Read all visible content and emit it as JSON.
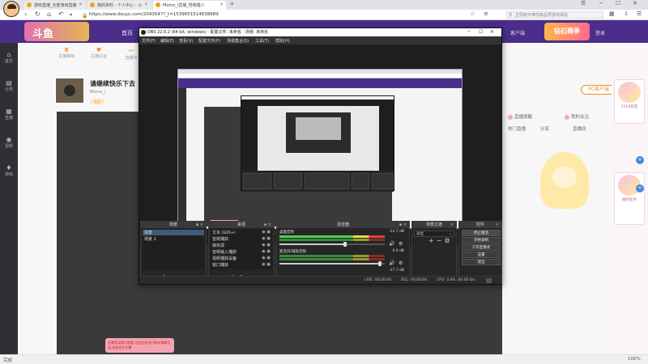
{
  "browser": {
    "tabs": [
      {
        "title": "游戏直播_全部游戏直播",
        "active": false
      },
      {
        "title": "我的资料 - 个人中心 - 斗",
        "active": false
      },
      {
        "title": "Momo_i直播_怪物猎人",
        "active": true
      }
    ],
    "url": "https://www.douyu.com/2043047?_t=1539651514838689",
    "search_placeholder": "正阳雨天带你高品质游戏体验"
  },
  "douyu": {
    "brand": "斗鱼",
    "promo_label": "钻石赛季",
    "header_left_text": "首页",
    "header_right_items": [
      "客户端",
      "观看历史",
      "登录"
    ],
    "left_nav": [
      {
        "icon": "⌂",
        "label": "首页"
      },
      {
        "icon": "▤",
        "label": "分类"
      },
      {
        "icon": "▦",
        "label": "直播"
      },
      {
        "icon": "◉",
        "label": "视频"
      },
      {
        "icon": "♦",
        "label": "游戏"
      }
    ],
    "room": {
      "title": "请继续快乐下去",
      "subtitle": "Momo_i",
      "follow_label": "关注",
      "stats": [
        {
          "value": "8",
          "label": "主播等级"
        },
        {
          "value": "♥",
          "label": "主播认证"
        },
        {
          "value": "〰",
          "label": "直播中"
        }
      ]
    },
    "right_panel": {
      "pc_button": "PC客户端",
      "items": [
        "直播提醒",
        "我的关注",
        "热门直播",
        "分享",
        "直播间"
      ]
    },
    "far_right": {
      "cards": [
        {
          "label": "2019年度"
        },
        {
          "label": "福利任务"
        }
      ],
      "dots": [
        "+",
        "+"
      ]
    },
    "toast": "无需登录即可观看,可在此处进行粉丝弹幕互动,欢迎关注主播"
  },
  "obs": {
    "title": "OBS 22.0.2 (64 bit, windows) - 配置文件: 未命名 - 场景: 未命名",
    "menu": [
      "文件(F)",
      "编辑(E)",
      "查看(V)",
      "配置文件(P)",
      "场景集合(S)",
      "工具(T)",
      "帮助(H)"
    ],
    "scenes_title": "场景",
    "scenes": [
      "场景",
      "场景 2"
    ],
    "sources_title": "来源",
    "sources": [
      "文本 (GDI+)",
      "音频捕获",
      "媒体源",
      "音频输入捕获",
      "视频捕获设备",
      "窗口捕获"
    ],
    "mixer_title": "混音器",
    "mixer": [
      {
        "name": "桌面音频",
        "db": "-12.7 dB",
        "level": 0.62
      },
      {
        "name": "麦克风/辅助音频",
        "db": "0.0 dB",
        "level": 0.95
      },
      {
        "name": "",
        "db": "-17.7 dB",
        "level": 0.2
      }
    ],
    "transitions_title": "场景过渡",
    "transition_value": "淡出",
    "controls_title": "控件",
    "controls": [
      "停止推流",
      "开始录制",
      "工作室模式",
      "设置",
      "退出"
    ],
    "status": {
      "live": "LIVE: 00:00:00",
      "rec": "REC: 00:00:00",
      "cpu": "CPU: 3.4%, 60.00 fps"
    }
  },
  "statusbar": {
    "left": "完成",
    "right": "100%"
  }
}
